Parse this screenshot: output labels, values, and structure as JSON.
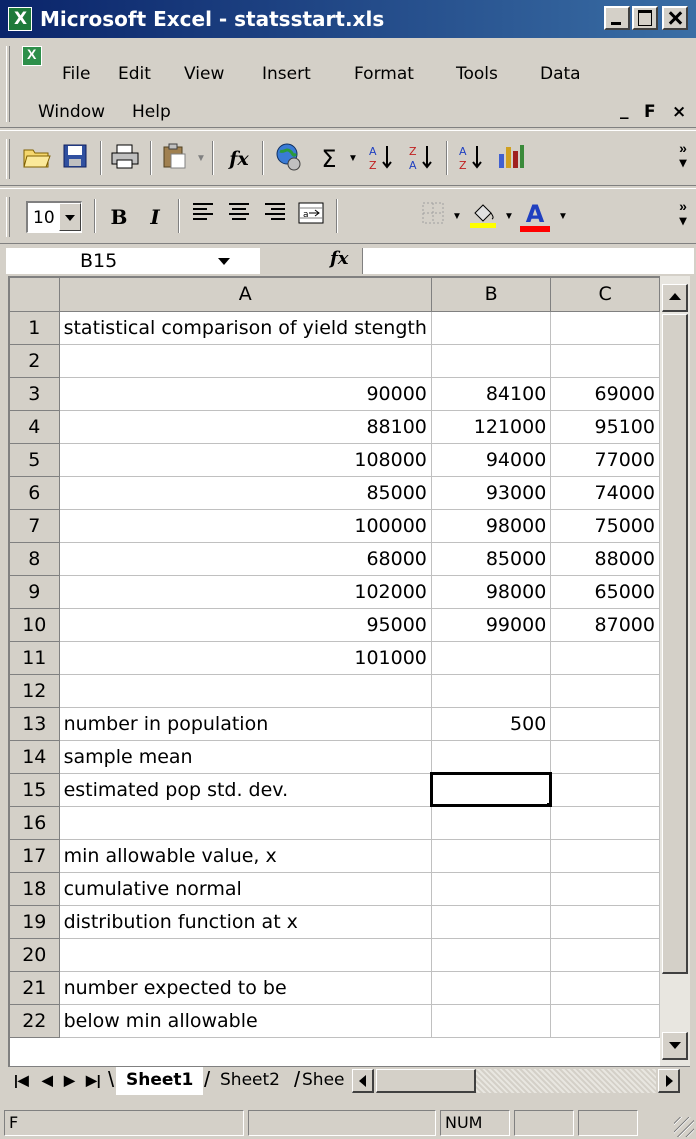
{
  "window": {
    "title": "Microsoft Excel - statsstart.xls"
  },
  "menu": {
    "items": [
      "File",
      "Edit",
      "View",
      "Insert",
      "Format",
      "Tools",
      "Data",
      "Window",
      "Help"
    ]
  },
  "toolbar_standard": {
    "icons": [
      "open-folder-icon",
      "save-icon",
      "print-icon",
      "paste-icon",
      "function-icon",
      "web-icon",
      "autosum-icon",
      "sort-ascending-icon",
      "sort-descending-icon",
      "sort-icon",
      "chart-icon"
    ],
    "function_symbol": "fx",
    "sum_symbol": "Σ"
  },
  "toolbar_format": {
    "font_size": "10",
    "bold": "B",
    "italic": "I",
    "font_color_label": "A",
    "fill_color": "#ffff00",
    "font_color": "#ff0000"
  },
  "formula_bar": {
    "name_box": "B15",
    "fx_label": "fx",
    "formula": ""
  },
  "grid": {
    "columns": [
      "A",
      "B",
      "C"
    ],
    "active_column": "B",
    "active_row": "15",
    "selected_cell": "B15",
    "rows": [
      {
        "n": "1",
        "a": "statistical comparison of yield stength",
        "b": "",
        "c": ""
      },
      {
        "n": "2",
        "a": "",
        "b": "",
        "c": ""
      },
      {
        "n": "3",
        "a": "90000",
        "b": "84100",
        "c": "69000"
      },
      {
        "n": "4",
        "a": "88100",
        "b": "121000",
        "c": "95100"
      },
      {
        "n": "5",
        "a": "108000",
        "b": "94000",
        "c": "77000"
      },
      {
        "n": "6",
        "a": "85000",
        "b": "93000",
        "c": "74000"
      },
      {
        "n": "7",
        "a": "100000",
        "b": "98000",
        "c": "75000"
      },
      {
        "n": "8",
        "a": "68000",
        "b": "85000",
        "c": "88000"
      },
      {
        "n": "9",
        "a": "102000",
        "b": "98000",
        "c": "65000"
      },
      {
        "n": "10",
        "a": "95000",
        "b": "99000",
        "c": "87000"
      },
      {
        "n": "11",
        "a": "101000",
        "b": "",
        "c": ""
      },
      {
        "n": "12",
        "a": "",
        "b": "",
        "c": ""
      },
      {
        "n": "13",
        "a": "number in population",
        "b": "500",
        "c": ""
      },
      {
        "n": "14",
        "a": "sample mean",
        "b": "",
        "c": ""
      },
      {
        "n": "15",
        "a": "estimated pop std. dev.",
        "b": "",
        "c": ""
      },
      {
        "n": "16",
        "a": "",
        "b": "",
        "c": ""
      },
      {
        "n": "17",
        "a": "min allowable value, x",
        "b": "",
        "c": ""
      },
      {
        "n": "18",
        "a": "cumulative normal",
        "b": "",
        "c": ""
      },
      {
        "n": "19",
        "a": "distribution function at x",
        "b": "",
        "c": ""
      },
      {
        "n": "20",
        "a": "",
        "b": "",
        "c": ""
      },
      {
        "n": "21",
        "a": "number expected to be",
        "b": "",
        "c": ""
      },
      {
        "n": "22",
        "a": "below min allowable",
        "b": "",
        "c": ""
      }
    ]
  },
  "sheet_tabs": {
    "tabs": [
      "Sheet1",
      "Sheet2",
      "Shee"
    ],
    "active": "Sheet1"
  },
  "status_bar": {
    "left": "F",
    "num": "NUM"
  }
}
